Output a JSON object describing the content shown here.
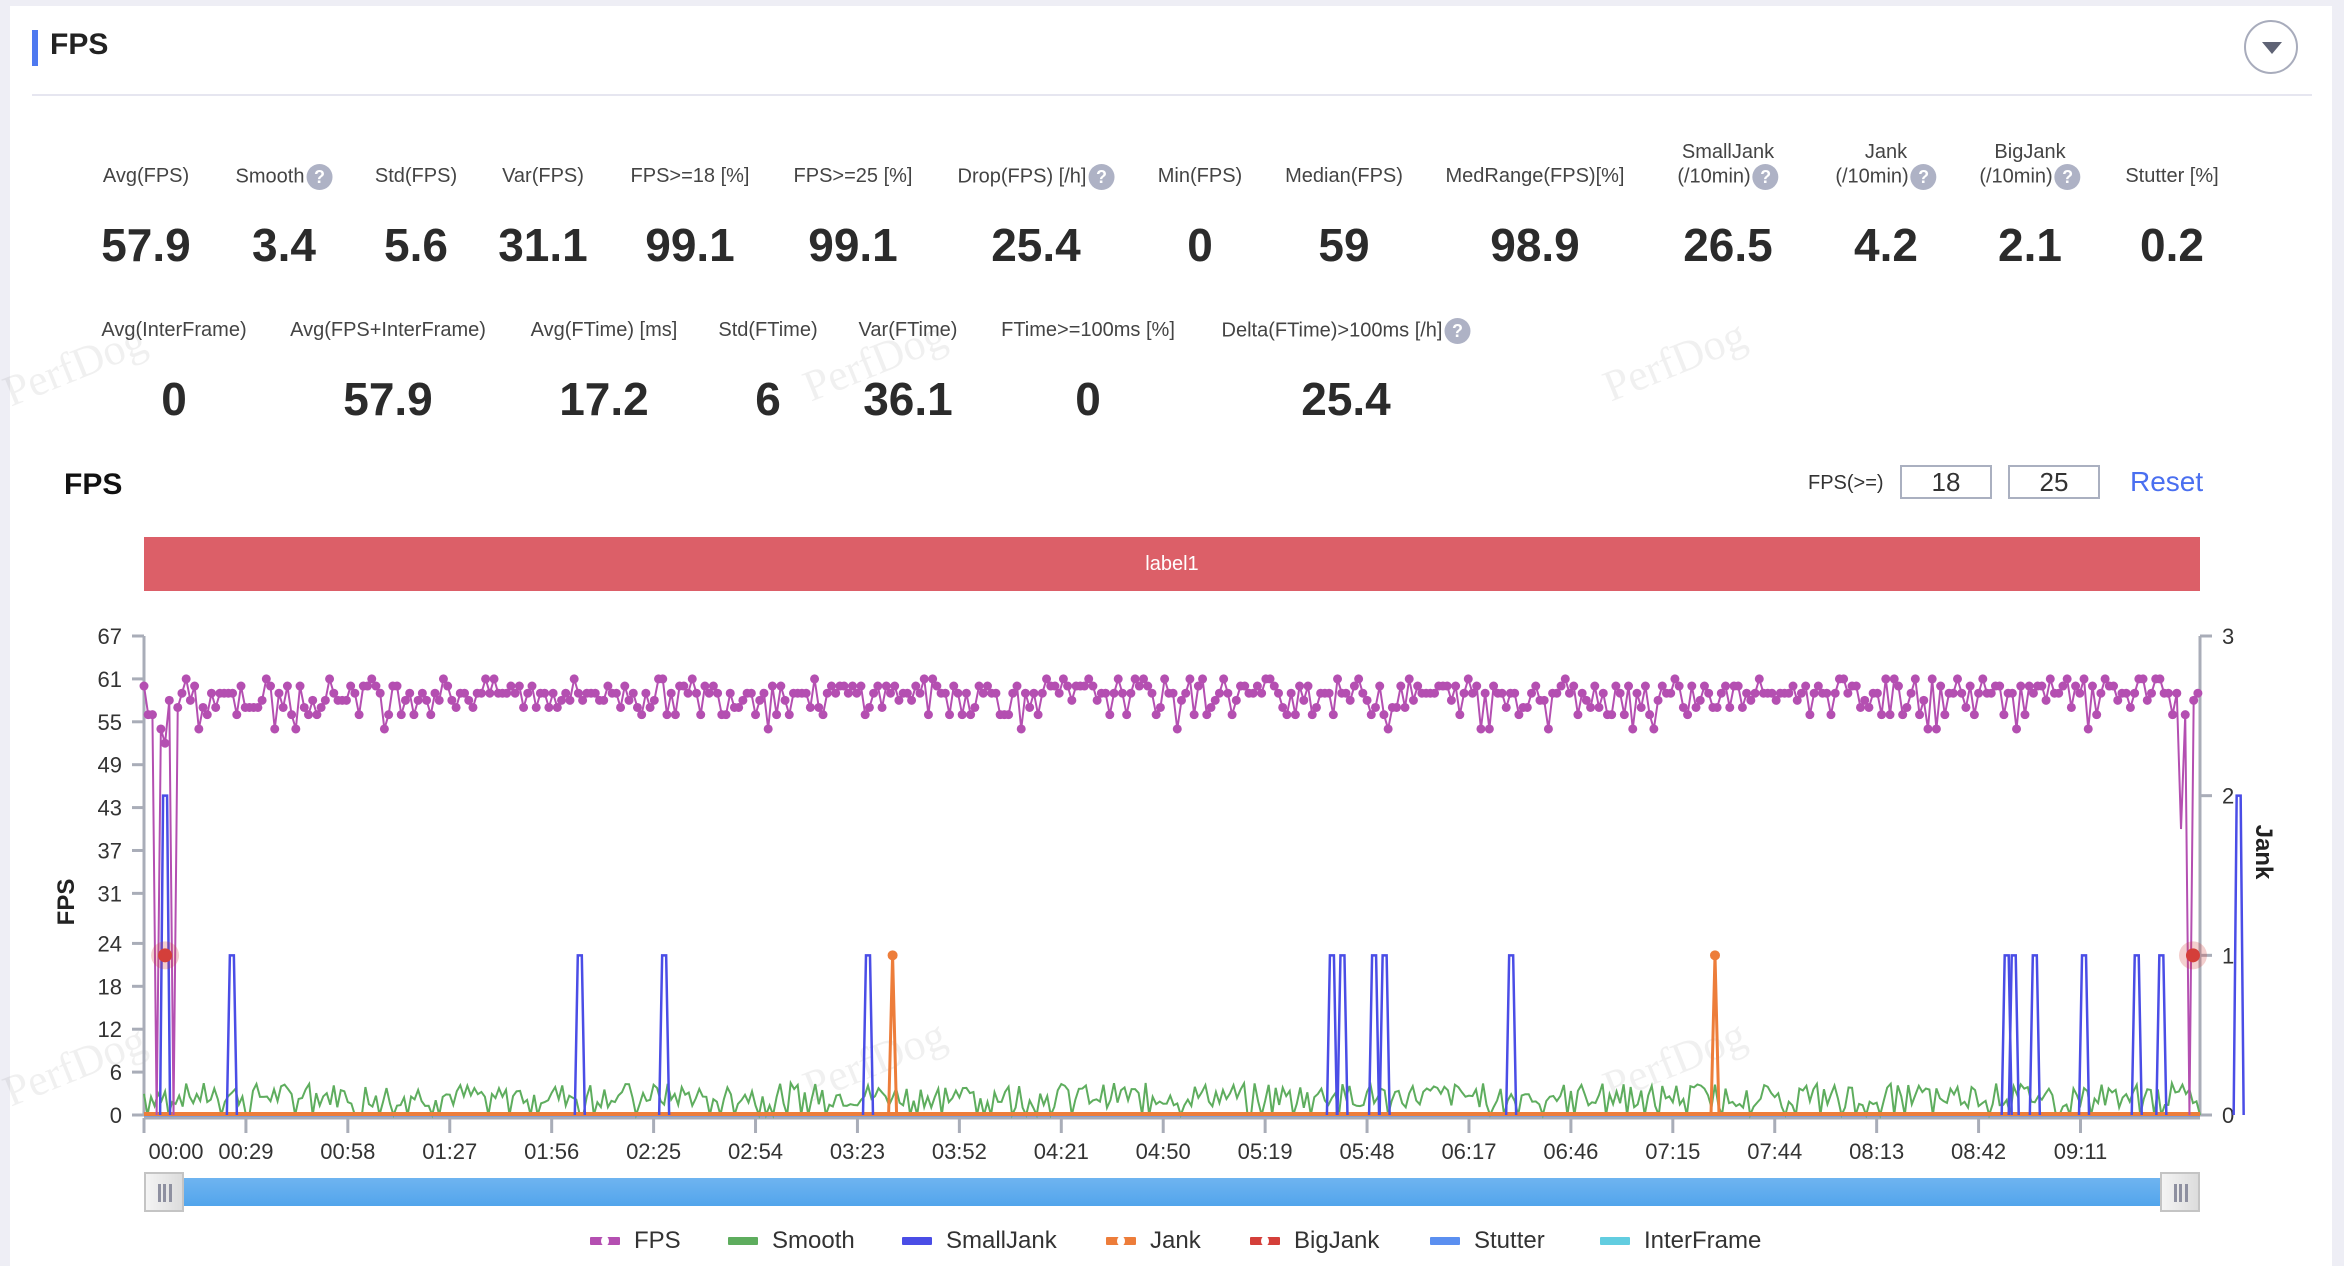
{
  "header": {
    "title": "FPS",
    "collapse_icon": "caret-down-icon"
  },
  "metrics_row1": [
    {
      "label": "Avg(FPS)",
      "value": "57.9",
      "help": false
    },
    {
      "label": "Smooth",
      "value": "3.4",
      "help": true
    },
    {
      "label": "Std(FPS)",
      "value": "5.6",
      "help": false
    },
    {
      "label": "Var(FPS)",
      "value": "31.1",
      "help": false
    },
    {
      "label": "FPS>=18 [%]",
      "value": "99.1",
      "help": false
    },
    {
      "label": "FPS>=25 [%]",
      "value": "99.1",
      "help": false
    },
    {
      "label": "Drop(FPS) [/h]",
      "value": "25.4",
      "help": true
    },
    {
      "label": "Min(FPS)",
      "value": "0",
      "help": false
    },
    {
      "label": "Median(FPS)",
      "value": "59",
      "help": false
    },
    {
      "label": "MedRange(FPS)[%]",
      "value": "98.9",
      "help": false
    },
    {
      "label": "SmallJank",
      "label2": "(/10min)",
      "value": "26.5",
      "help": true
    },
    {
      "label": "Jank",
      "label2": "(/10min)",
      "value": "4.2",
      "help": true
    },
    {
      "label": "BigJank",
      "label2": "(/10min)",
      "value": "2.1",
      "help": true
    },
    {
      "label": "Stutter [%]",
      "value": "0.2",
      "help": false
    }
  ],
  "metrics_row2": [
    {
      "label": "Avg(InterFrame)",
      "value": "0",
      "help": false
    },
    {
      "label": "Avg(FPS+InterFrame)",
      "value": "57.9",
      "help": false
    },
    {
      "label": "Avg(FTime) [ms]",
      "value": "17.2",
      "help": false
    },
    {
      "label": "Std(FTime)",
      "value": "6",
      "help": false
    },
    {
      "label": "Var(FTime)",
      "value": "36.1",
      "help": false
    },
    {
      "label": "FTime>=100ms [%]",
      "value": "0",
      "help": false
    },
    {
      "label": "Delta(FTime)>100ms [/h]",
      "value": "25.4",
      "help": true
    }
  ],
  "help_glyph": "?",
  "watermark": "PerfDog",
  "chart_section": {
    "title": "FPS",
    "threshold_label": "FPS(>=)",
    "threshold_1": "18",
    "threshold_2": "25",
    "reset_label": "Reset",
    "label_band": "label1"
  },
  "slider": {
    "start": 0.0,
    "end": 1.0
  },
  "chart_data": {
    "type": "line",
    "title": "FPS",
    "xlabel": "",
    "ylabel": "FPS",
    "y2label": "Jank",
    "x_tick_labels": [
      "00:00",
      "00:29",
      "00:58",
      "01:27",
      "01:56",
      "02:25",
      "02:54",
      "03:23",
      "03:52",
      "04:21",
      "04:50",
      "05:19",
      "05:48",
      "06:17",
      "06:46",
      "07:15",
      "07:44",
      "08:13",
      "08:42",
      "09:11"
    ],
    "x_range_seconds": [
      0,
      585
    ],
    "y_ticks": [
      0,
      6,
      12,
      18,
      24,
      31,
      37,
      43,
      49,
      55,
      61,
      67
    ],
    "y_range": [
      0,
      67
    ],
    "y2_ticks": [
      0,
      1,
      2,
      3
    ],
    "y2_range": [
      0,
      3
    ],
    "legend_position": "bottom",
    "colors": {
      "FPS": "#b44fb1",
      "Smooth": "#5ead5e",
      "SmallJank": "#4a4de6",
      "Jank": "#ed7d3a",
      "BigJank": "#d43f3a",
      "Stutter": "#5b8ff0",
      "InterFrame": "#62cde0"
    },
    "fps_series_summary": {
      "typical_range": [
        56,
        61
      ],
      "avg": 57.9,
      "dips": [
        {
          "t": 4,
          "v": 0
        },
        {
          "t": 6,
          "v": 52
        },
        {
          "t": 8,
          "v": 0
        },
        {
          "t": 580,
          "v": 40
        },
        {
          "t": 582,
          "v": 0
        }
      ]
    },
    "smooth_series_summary": {
      "typical_range": [
        0,
        5
      ]
    },
    "small_jank_events": [
      {
        "t": 6,
        "v": 2
      },
      {
        "t": 25,
        "v": 1
      },
      {
        "t": 124,
        "v": 1
      },
      {
        "t": 148,
        "v": 1
      },
      {
        "t": 206,
        "v": 1
      },
      {
        "t": 338,
        "v": 1
      },
      {
        "t": 341,
        "v": 1
      },
      {
        "t": 350,
        "v": 1
      },
      {
        "t": 353,
        "v": 1
      },
      {
        "t": 389,
        "v": 1
      },
      {
        "t": 538,
        "v": 1
      },
      {
        "t": 567,
        "v": 1
      },
      {
        "t": 596,
        "v": 2
      },
      {
        "t": 530,
        "v": 1
      },
      {
        "t": 532,
        "v": 1
      },
      {
        "t": 552,
        "v": 1
      },
      {
        "t": 574,
        "v": 1
      }
    ],
    "jank_events": [
      {
        "t": 213,
        "v": 1
      },
      {
        "t": 447,
        "v": 1
      }
    ],
    "big_jank_events": [
      {
        "t": 6,
        "v": 1
      },
      {
        "t": 583,
        "v": 1
      }
    ],
    "series": [
      {
        "name": "FPS",
        "marker": true
      },
      {
        "name": "Smooth",
        "marker": false
      },
      {
        "name": "SmallJank",
        "marker": false
      },
      {
        "name": "Jank",
        "marker": true
      },
      {
        "name": "BigJank",
        "marker": true
      },
      {
        "name": "Stutter",
        "marker": false
      },
      {
        "name": "InterFrame",
        "marker": false
      }
    ]
  }
}
